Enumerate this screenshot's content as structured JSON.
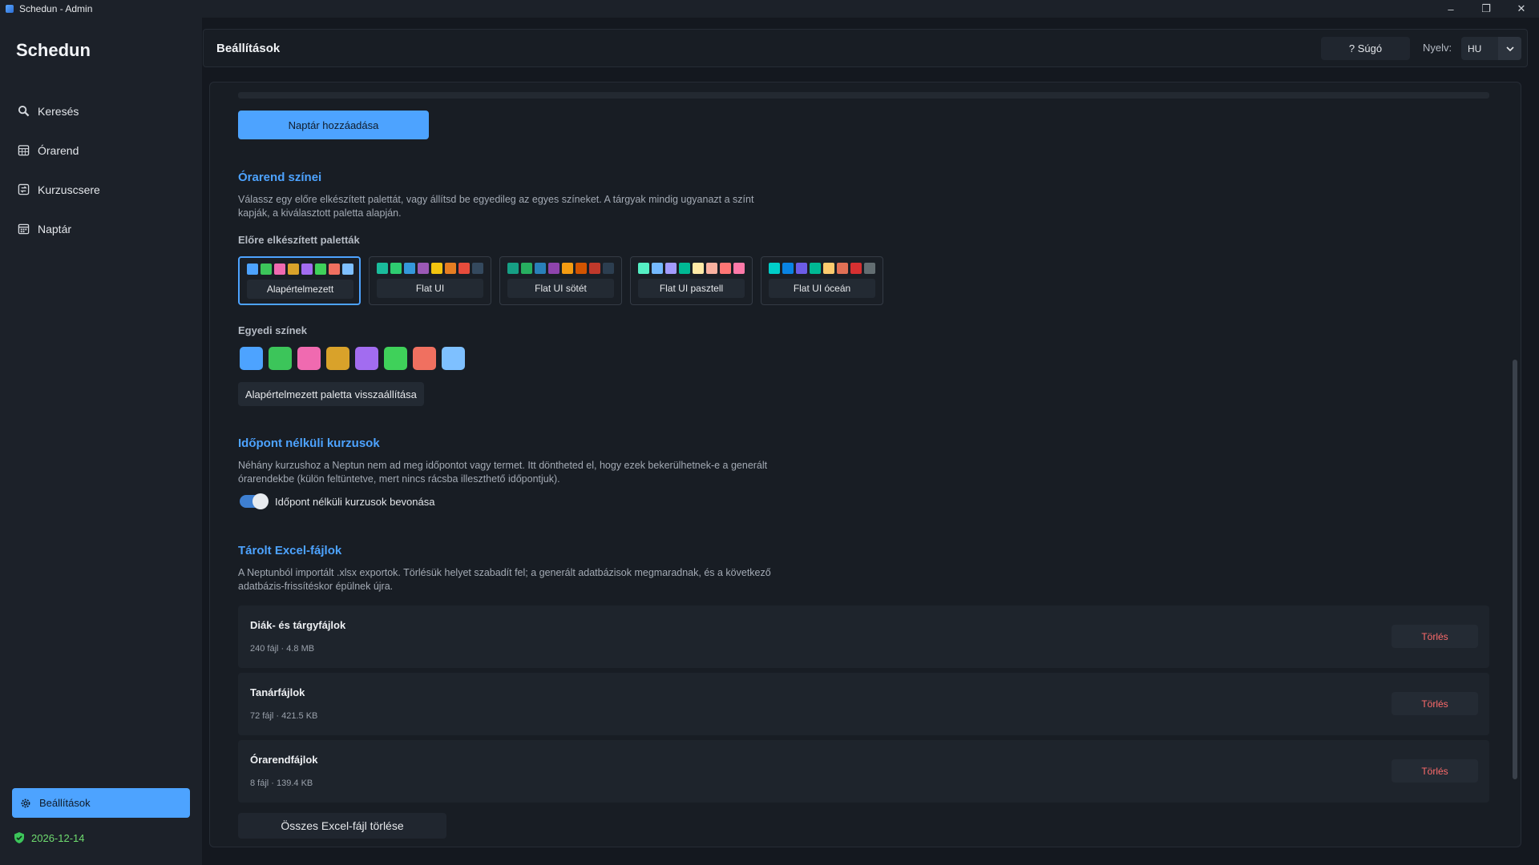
{
  "window": {
    "title": "Schedun - Admin",
    "minimize": "–",
    "restore": "❐",
    "close": "✕"
  },
  "sidebar": {
    "brand": "Schedun",
    "items": [
      {
        "label": "Keresés",
        "icon": "search-icon"
      },
      {
        "label": "Órarend",
        "icon": "calendar-grid-icon"
      },
      {
        "label": "Kurzuscsere",
        "icon": "swap-icon"
      },
      {
        "label": "Naptár",
        "icon": "calendar-icon"
      }
    ],
    "settings_label": "Beállítások",
    "license_date": "2026-12-14"
  },
  "header": {
    "title": "Beállítások",
    "help_label": "?  Súgó",
    "lang_label": "Nyelv:",
    "lang_value": "HU"
  },
  "main": {
    "add_calendar_label": "Naptár hozzáadása",
    "colors": {
      "title": "Órarend színei",
      "description": "Válassz egy előre elkészített palettát, vagy állítsd be egyedileg az egyes színeket. A tárgyak mindig ugyanazt a színt kapják, a kiválasztott paletta alapján.",
      "palettes_label": "Előre elkészített paletták",
      "palettes": [
        {
          "name": "Alapértelmezett",
          "selected": true,
          "colors": [
            "#4da3ff",
            "#3cc55a",
            "#f06ab0",
            "#d9a22a",
            "#a26cf0",
            "#3fd15a",
            "#f07060",
            "#7ec0ff"
          ]
        },
        {
          "name": "Flat UI",
          "selected": false,
          "colors": [
            "#1abc9c",
            "#2ecc71",
            "#3498db",
            "#9b59b6",
            "#f1c40f",
            "#e67e22",
            "#e74c3c",
            "#34495e"
          ]
        },
        {
          "name": "Flat UI sötét",
          "selected": false,
          "colors": [
            "#16a085",
            "#27ae60",
            "#2980b9",
            "#8e44ad",
            "#f39c12",
            "#d35400",
            "#c0392b",
            "#2c3e50"
          ]
        },
        {
          "name": "Flat UI pasztell",
          "selected": false,
          "colors": [
            "#55efc4",
            "#74b9ff",
            "#a29bfe",
            "#00b894",
            "#ffeaa7",
            "#fab1a0",
            "#ff7675",
            "#fd79a8"
          ]
        },
        {
          "name": "Flat UI óceán",
          "selected": false,
          "colors": [
            "#00cec9",
            "#0984e3",
            "#6c5ce7",
            "#00b894",
            "#fdcb6e",
            "#e17055",
            "#d63031",
            "#636e72"
          ]
        }
      ],
      "custom_label": "Egyedi színek",
      "custom_colors": [
        "#4da3ff",
        "#3cc55a",
        "#f06ab0",
        "#d9a22a",
        "#a26cf0",
        "#3fd15a",
        "#f07060",
        "#7ec0ff"
      ],
      "reset_label": "Alapértelmezett paletta visszaállítása"
    },
    "untimed": {
      "title": "Időpont nélküli kurzusok",
      "description": "Néhány kurzushoz a Neptun nem ad meg időpontot vagy termet. Itt döntheted el, hogy ezek bekerülhetnek-e a generált órarendekbe (külön feltüntetve, mert nincs rácsba illeszthető időpontjuk).",
      "toggle_label": "Időpont nélküli kurzusok bevonása",
      "toggle_on": true
    },
    "excel": {
      "title": "Tárolt Excel-fájlok",
      "description": "A Neptunból importált .xlsx exportok. Törlésük helyet szabadít fel; a generált adatbázisok megmaradnak, és a következő adatbázis-frissítéskor épülnek újra.",
      "files": [
        {
          "name": "Diák- és tárgyfájlok",
          "meta": "240 fájl · 4.8 MB",
          "delete_label": "Törlés"
        },
        {
          "name": "Tanárfájlok",
          "meta": "72 fájl · 421.5 KB",
          "delete_label": "Törlés"
        },
        {
          "name": "Órarendfájlok",
          "meta": "8 fájl · 139.4 KB",
          "delete_label": "Törlés"
        }
      ],
      "delete_all_label": "Összes Excel-fájl törlése"
    }
  }
}
